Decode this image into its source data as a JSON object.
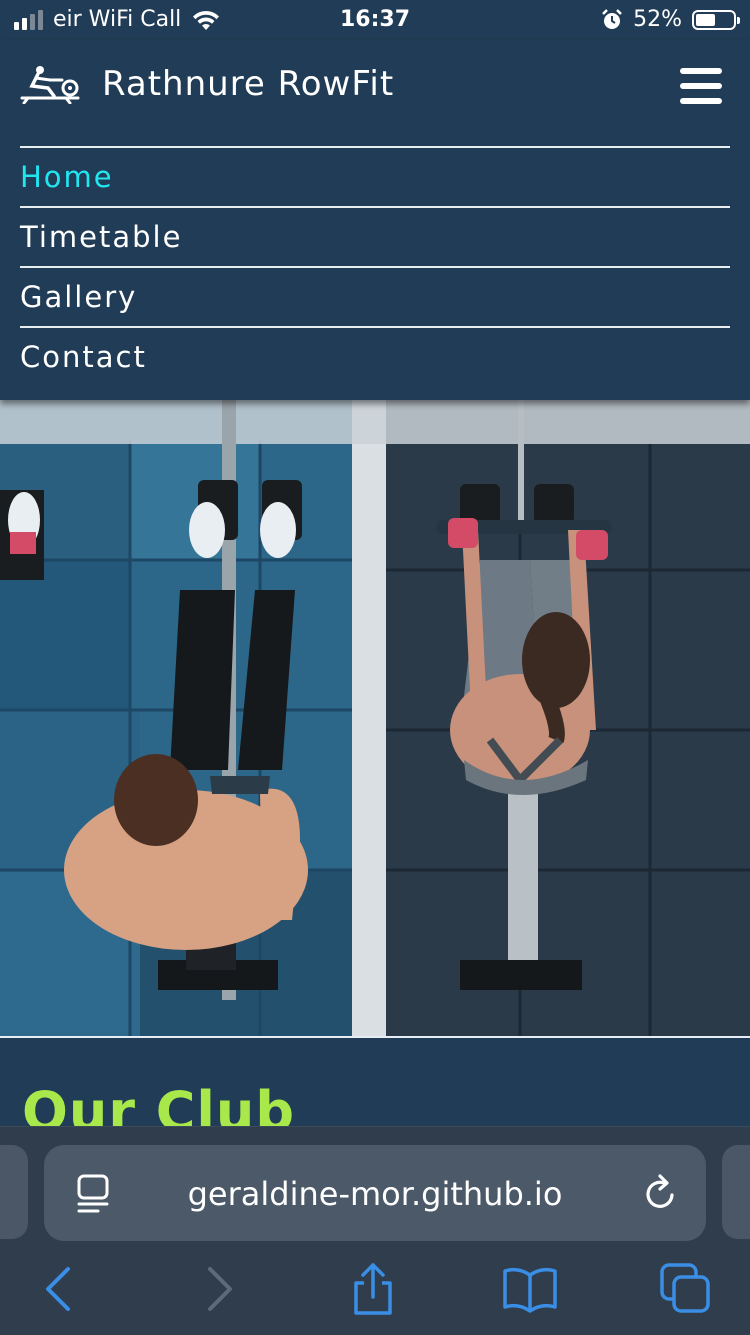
{
  "status_bar": {
    "carrier": "eir WiFi Call",
    "time": "16:37",
    "battery": "52%",
    "battery_level": 0.52,
    "icons": [
      "cellular-signal-icon",
      "wifi-icon",
      "alarm-icon",
      "battery-icon"
    ]
  },
  "header": {
    "site_title": "Rathnure RowFit",
    "logo_icon": "rower-logo-icon",
    "menu_icon": "hamburger-menu-icon"
  },
  "nav": {
    "items": [
      {
        "label": "Home",
        "active": true
      },
      {
        "label": "Timetable",
        "active": false
      },
      {
        "label": "Gallery",
        "active": false
      },
      {
        "label": "Contact",
        "active": false
      }
    ]
  },
  "hero": {
    "image": "overhead view of two people on rowing machines in a gym"
  },
  "main": {
    "section_title": "Our Club"
  },
  "browser": {
    "url": "geraldine-mor.github.io",
    "icons": [
      "reader-mode-icon",
      "reload-icon",
      "back-icon",
      "forward-icon",
      "share-icon",
      "bookmarks-icon",
      "tabs-icon"
    ]
  },
  "colors": {
    "background": "#213c56",
    "nav_active": "#21e6f0",
    "section_title": "#a9e84a",
    "browser_accent": "#3a8ee6"
  }
}
